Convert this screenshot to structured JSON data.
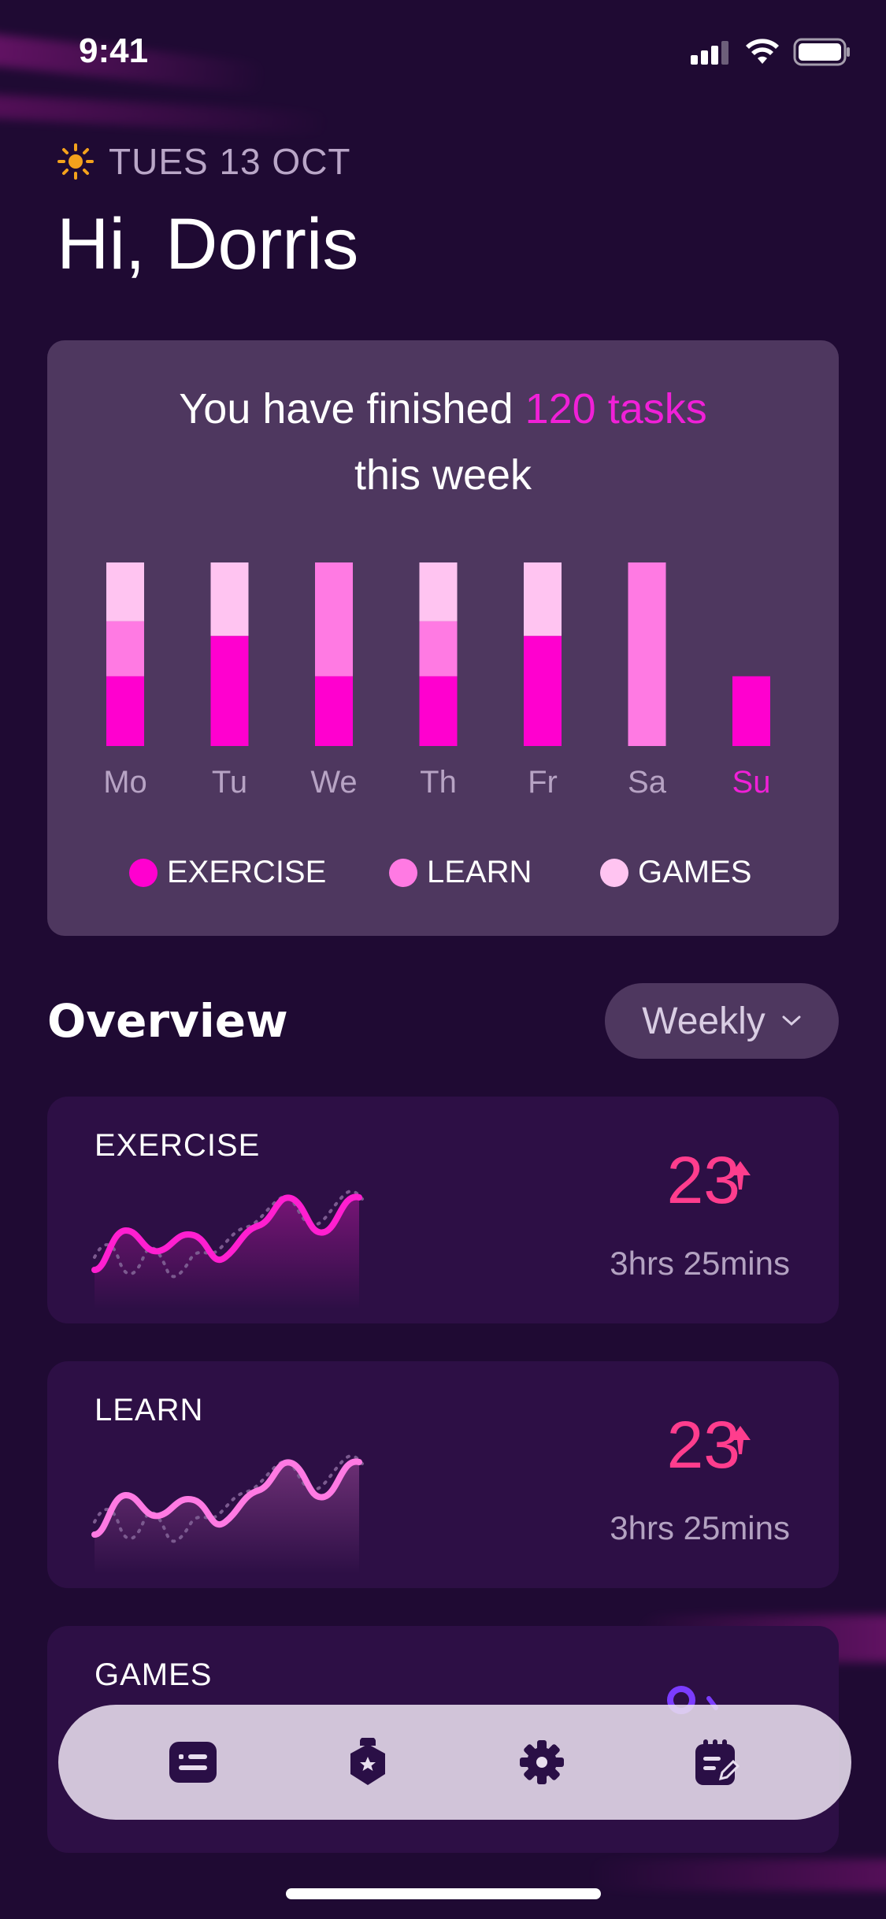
{
  "status_bar": {
    "time": "9:41"
  },
  "header": {
    "date": "TUES 13 OCT",
    "greeting": "Hi, Dorris"
  },
  "summary": {
    "line1_prefix": "You have finished ",
    "line1_highlight": "120 tasks",
    "line2": "this week"
  },
  "chart_data": {
    "type": "bar",
    "stacked": true,
    "categories": [
      "Mo",
      "Tu",
      "We",
      "Th",
      "Fr",
      "Sa",
      "Su"
    ],
    "highlighted_category": "Su",
    "series": [
      {
        "name": "EXERCISE",
        "color": "#ff00cf",
        "values": [
          38,
          60,
          38,
          38,
          60,
          0,
          38
        ]
      },
      {
        "name": "LEARN",
        "color": "#ff7ae3",
        "values": [
          30,
          0,
          62,
          30,
          0,
          100,
          0
        ]
      },
      {
        "name": "GAMES",
        "color": "#ffc4f1",
        "values": [
          32,
          40,
          0,
          32,
          40,
          0,
          0
        ]
      }
    ],
    "ylim": [
      0,
      100
    ]
  },
  "legend": [
    {
      "label": "EXERCISE",
      "color": "#ff00cf"
    },
    {
      "label": "LEARN",
      "color": "#ff7ae3"
    },
    {
      "label": "GAMES",
      "color": "#ffc4f1"
    }
  ],
  "overview": {
    "title": "Overview",
    "period_selector": "Weekly",
    "cards": [
      {
        "label": "EXERCISE",
        "count": "23",
        "duration": "3hrs 25mins",
        "line_color": "#ff1fd0"
      },
      {
        "label": "LEARN",
        "count": "23",
        "duration": "3hrs 25mins",
        "line_color": "#ff7ae3"
      },
      {
        "label": "GAMES"
      }
    ]
  },
  "tab_bar": {
    "items": [
      {
        "icon": "list-card-icon"
      },
      {
        "icon": "shield-badge-icon"
      },
      {
        "icon": "gear-icon"
      },
      {
        "icon": "notes-edit-icon"
      }
    ]
  },
  "colors": {
    "background": "#1f0a33",
    "card": "#4e375f",
    "accent": "#f020d7",
    "stat_value": "#ff3d8d"
  }
}
